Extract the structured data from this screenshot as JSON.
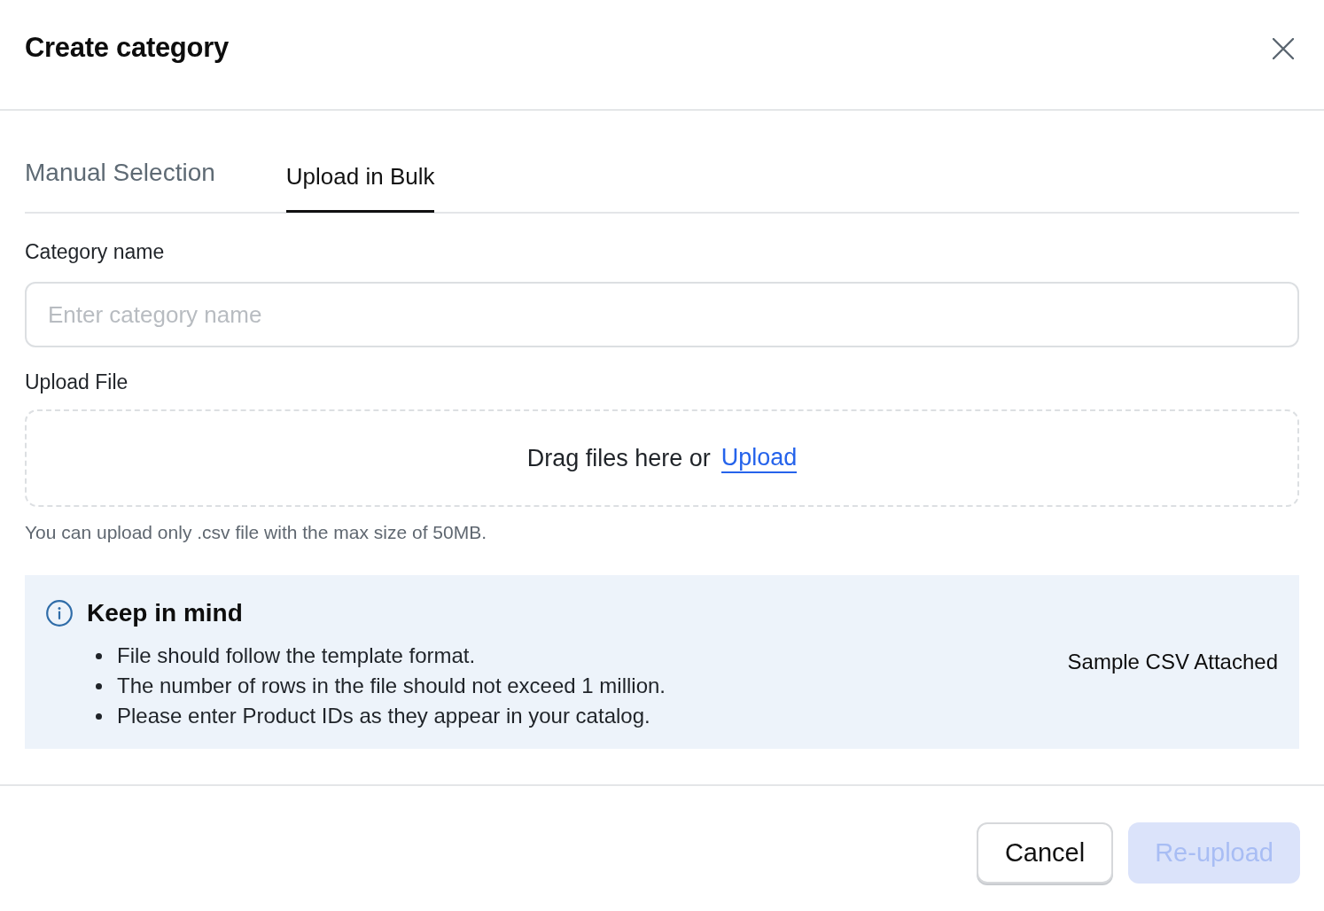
{
  "dialog": {
    "title": "Create category"
  },
  "tabs": [
    {
      "label": "Manual Selection",
      "selected": false
    },
    {
      "label": "Upload in Bulk",
      "selected": true
    }
  ],
  "category_name": {
    "label": "Category name",
    "placeholder": "Enter category name"
  },
  "upload_file": {
    "label": "Upload File",
    "drop_text": "Drag files here or",
    "link": "Upload",
    "hint": "You can upload only .csv file with the max size of 50MB."
  },
  "keep_in_mind": {
    "title": "Keep in mind",
    "items": [
      "File should follow the template format.",
      "The number of rows in the file should not exceed 1 million.",
      "Please enter Product IDs as they appear in your catalog."
    ],
    "attachment": "Sample CSV Attached"
  },
  "buttons": [
    {
      "label": "Cancel",
      "kind": "secondary",
      "disabled": false
    },
    {
      "label": "Re-upload",
      "kind": "primary",
      "disabled": true
    }
  ]
}
